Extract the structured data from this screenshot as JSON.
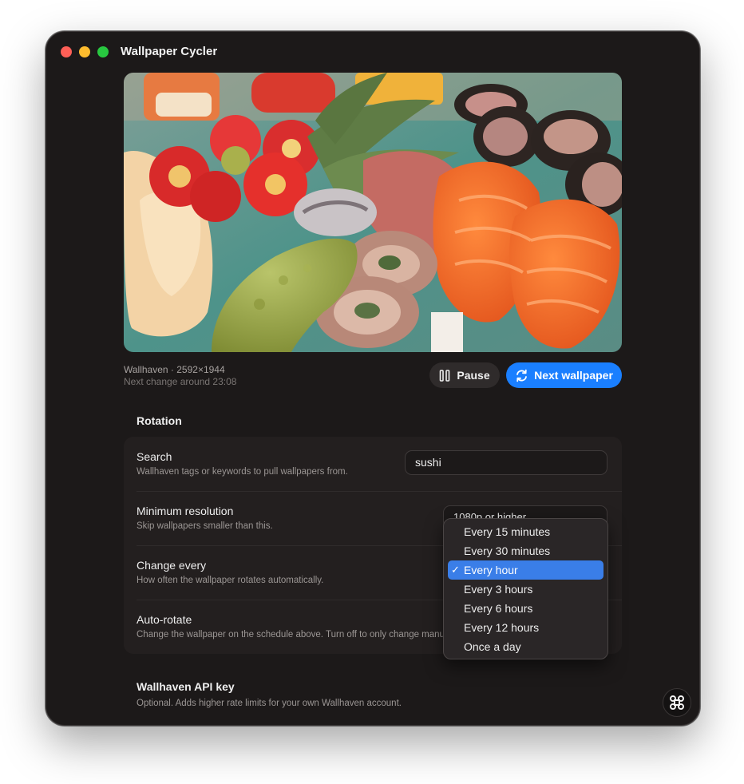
{
  "window": {
    "title": "Wallpaper Cycler"
  },
  "wallpaper": {
    "source_line": "Wallhaven · 2592×1944",
    "next_change": "Next change around 23:08"
  },
  "actions": {
    "pause_label": "Pause",
    "next_label": "Next wallpaper",
    "accent_color": "#1a7fff"
  },
  "rotation": {
    "section_title": "Rotation",
    "search": {
      "label": "Search",
      "help": "Wallhaven tags or keywords to pull wallpapers from.",
      "value": "sushi"
    },
    "min_resolution": {
      "label": "Minimum resolution",
      "help": "Skip wallpapers smaller than this.",
      "selected": "1080p or higher"
    },
    "change_every": {
      "label": "Change every",
      "help": "How often the wallpaper rotates automatically.",
      "options": [
        "Every 15 minutes",
        "Every 30 minutes",
        "Every hour",
        "Every 3 hours",
        "Every 6 hours",
        "Every 12 hours",
        "Once a day"
      ],
      "selected": "Every hour"
    },
    "auto_rotate": {
      "label": "Auto-rotate",
      "help": "Change the wallpaper on the schedule above. Turn off to only change manually.",
      "enabled": true
    }
  },
  "api": {
    "title": "Wallhaven API key",
    "help": "Optional. Adds higher rate limits for your own Wallhaven account."
  },
  "icons": {
    "pause": "pause-icon",
    "refresh": "refresh-icon",
    "corner": "command-icon",
    "check": "checkmark-icon"
  }
}
